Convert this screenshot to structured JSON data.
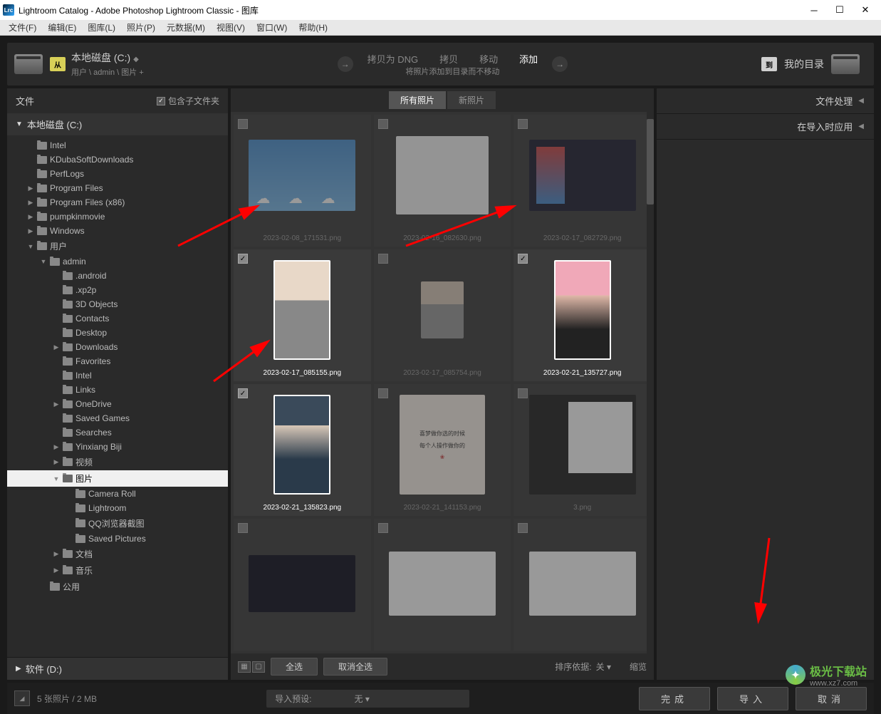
{
  "titlebar": {
    "app_icon": "Lrc",
    "title": "Lightroom Catalog - Adobe Photoshop Lightroom Classic - 图库"
  },
  "menubar": [
    "文件(F)",
    "编辑(E)",
    "图库(L)",
    "照片(P)",
    "元数据(M)",
    "视图(V)",
    "窗口(W)",
    "帮助(H)"
  ],
  "topbar": {
    "from_badge": "从",
    "source_title": "本地磁盘 (C:)",
    "source_path": "用户 \\ admin \\ 图片 +",
    "modes": {
      "dng": "拷贝为 DNG",
      "copy": "拷贝",
      "move": "移动",
      "add": "添加"
    },
    "mode_sub": "将照片添加到目录而不移动",
    "dest_badge": "到",
    "dest_label": "我的目录"
  },
  "left": {
    "header": "文件",
    "include_sub": "包含子文件夹",
    "section": "本地磁盘 (C:)",
    "footer": "软件 (D:)",
    "tree": [
      {
        "depth": 1,
        "exp": "",
        "label": "Intel"
      },
      {
        "depth": 1,
        "exp": "",
        "label": "KDubaSoftDownloads"
      },
      {
        "depth": 1,
        "exp": "",
        "label": "PerfLogs"
      },
      {
        "depth": 1,
        "exp": "▶",
        "label": "Program Files"
      },
      {
        "depth": 1,
        "exp": "▶",
        "label": "Program Files (x86)"
      },
      {
        "depth": 1,
        "exp": "▶",
        "label": "pumpkinmovie"
      },
      {
        "depth": 1,
        "exp": "▶",
        "label": "Windows"
      },
      {
        "depth": 1,
        "exp": "▼",
        "label": "用户"
      },
      {
        "depth": 2,
        "exp": "▼",
        "label": "admin"
      },
      {
        "depth": 3,
        "exp": "",
        "label": ".android"
      },
      {
        "depth": 3,
        "exp": "",
        "label": ".xp2p"
      },
      {
        "depth": 3,
        "exp": "",
        "label": "3D Objects"
      },
      {
        "depth": 3,
        "exp": "",
        "label": "Contacts"
      },
      {
        "depth": 3,
        "exp": "",
        "label": "Desktop"
      },
      {
        "depth": 3,
        "exp": "▶",
        "label": "Downloads"
      },
      {
        "depth": 3,
        "exp": "",
        "label": "Favorites"
      },
      {
        "depth": 3,
        "exp": "",
        "label": "Intel"
      },
      {
        "depth": 3,
        "exp": "",
        "label": "Links"
      },
      {
        "depth": 3,
        "exp": "▶",
        "label": "OneDrive"
      },
      {
        "depth": 3,
        "exp": "",
        "label": "Saved Games"
      },
      {
        "depth": 3,
        "exp": "",
        "label": "Searches"
      },
      {
        "depth": 3,
        "exp": "▶",
        "label": "Yinxiang Biji"
      },
      {
        "depth": 3,
        "exp": "▶",
        "label": "视频"
      },
      {
        "depth": 3,
        "exp": "▼",
        "label": "图片",
        "selected": true
      },
      {
        "depth": 4,
        "exp": "",
        "label": "Camera Roll"
      },
      {
        "depth": 4,
        "exp": "",
        "label": "Lightroom"
      },
      {
        "depth": 4,
        "exp": "",
        "label": "QQ浏览器截图"
      },
      {
        "depth": 4,
        "exp": "",
        "label": "Saved Pictures"
      },
      {
        "depth": 3,
        "exp": "▶",
        "label": "文档"
      },
      {
        "depth": 3,
        "exp": "▶",
        "label": "音乐"
      },
      {
        "depth": 2,
        "exp": "",
        "label": "公用"
      }
    ]
  },
  "center": {
    "tabs": {
      "all": "所有照片",
      "new": "新照片"
    },
    "thumbs": [
      {
        "caption": "2023-02-08_171531.png",
        "kind": "sky",
        "checked": false,
        "dim": true
      },
      {
        "caption": "2023-02-16_082630.png",
        "kind": "doc",
        "checked": false,
        "dim": true
      },
      {
        "caption": "2023-02-17_082729.png",
        "kind": "app-ui",
        "checked": false,
        "dim": true
      },
      {
        "caption": "2023-02-17_085155.png",
        "kind": "portrait",
        "checked": true,
        "dim": false,
        "selected": true
      },
      {
        "caption": "2023-02-17_085754.png",
        "kind": "dim-small",
        "checked": false,
        "dim": true
      },
      {
        "caption": "2023-02-21_135727.png",
        "kind": "pink",
        "checked": true,
        "dim": false,
        "selected": true
      },
      {
        "caption": "2023-02-21_135823.png",
        "kind": "dark",
        "checked": true,
        "dim": false,
        "selected": true
      },
      {
        "caption": "2023-02-21_141153.png",
        "kind": "text",
        "checked": false,
        "dim": true
      },
      {
        "caption": "3.png",
        "kind": "code",
        "checked": false,
        "dim": true
      },
      {
        "caption": "",
        "kind": "ui-dark",
        "checked": false,
        "dim": true
      },
      {
        "caption": "",
        "kind": "ui-table",
        "checked": false,
        "dim": true
      },
      {
        "caption": "",
        "kind": "ui-table",
        "checked": false,
        "dim": true
      }
    ],
    "footer": {
      "select_all": "全选",
      "deselect": "取消全选",
      "sort_label": "排序依据:",
      "sort_value": "关",
      "zoom": "缩览"
    },
    "text_img_lines": [
      "喜梦做你选的时候",
      "每个人操作做你的"
    ]
  },
  "right": {
    "items": [
      {
        "label": "文件处理"
      },
      {
        "label": "在导入时应用"
      }
    ]
  },
  "bottom": {
    "status": "5 张照片 / 2 MB",
    "preset_label": "导入预设:",
    "preset_value": "无",
    "done": "完成",
    "import": "导入",
    "cancel": "取消"
  },
  "watermark": {
    "name": "极光下载站",
    "url": "www.xz7.com"
  }
}
